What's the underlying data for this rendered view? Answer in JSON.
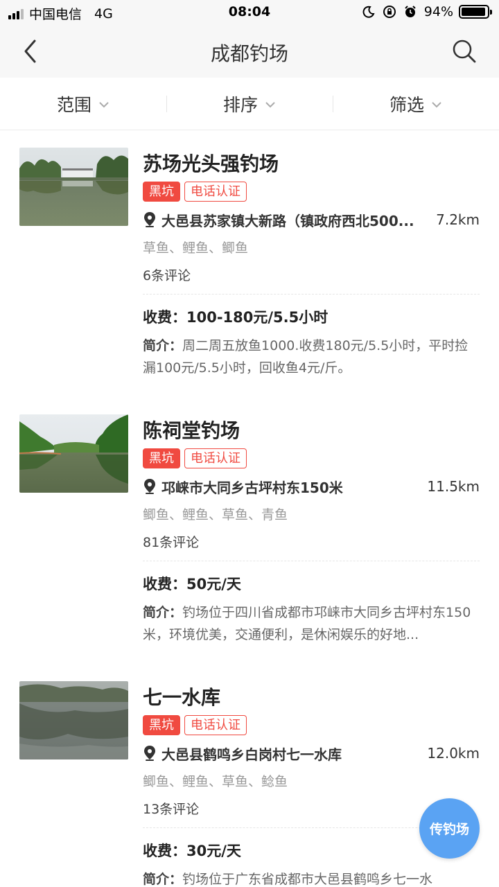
{
  "status_bar": {
    "carrier": "中国电信",
    "network": "4G",
    "time": "08:04",
    "battery": "94%",
    "battery_level": 0.94,
    "icons": [
      "moon-icon",
      "rotation-lock-icon",
      "alarm-icon",
      "battery-icon"
    ]
  },
  "nav": {
    "title": "成都钓场",
    "back_icon": "back-icon",
    "search_icon": "search-icon"
  },
  "filters": [
    {
      "label": "范围",
      "icon": "chevron-down-icon"
    },
    {
      "label": "排序",
      "icon": "chevron-down-icon"
    },
    {
      "label": "筛选",
      "icon": "chevron-down-icon"
    }
  ],
  "colors": {
    "tag_red": "#f04a40",
    "fab_blue": "#5aa3f3",
    "muted_text": "#999999"
  },
  "spots": [
    {
      "name": "苏场光头强钓场",
      "tags": [
        "黑坑",
        "电话认证"
      ],
      "address": "大邑县苏家镇大新路（镇政府西北500...",
      "distance": "7.2km",
      "fish": "草鱼、鲤鱼、鲫鱼",
      "reviews": "6条评论",
      "fee_label": "收费：",
      "fee": "100-180元/5.5小时",
      "intro_label": "简介：",
      "intro": "周二周五放鱼1000.收费180元/5.5小时，平时捡漏100元/5.5小时，回收鱼4元/斤。"
    },
    {
      "name": "陈祠堂钓场",
      "tags": [
        "黑坑",
        "电话认证"
      ],
      "address": "邛崃市大同乡古坪村东150米",
      "distance": "11.5km",
      "fish": "鲫鱼、鲤鱼、草鱼、青鱼",
      "reviews": "81条评论",
      "fee_label": "收费：",
      "fee": "50元/天",
      "intro_label": "简介：",
      "intro": "钓场位于四川省成都市邛崃市大同乡古坪村东150米，环境优美，交通便利，是休闲娱乐的好地..."
    },
    {
      "name": "七一水库",
      "tags": [
        "黑坑",
        "电话认证"
      ],
      "address": "大邑县鹤鸣乡白岗村七一水库",
      "distance": "12.0km",
      "fish": "鲫鱼、鲤鱼、草鱼、鲶鱼",
      "reviews": "13条评论",
      "fee_label": "收费：",
      "fee": "30元/天",
      "intro_label": "简介：",
      "intro": "钓场位于广东省成都市大邑县鹤鸣乡七一水"
    }
  ],
  "fab": {
    "label": "传钓场"
  }
}
